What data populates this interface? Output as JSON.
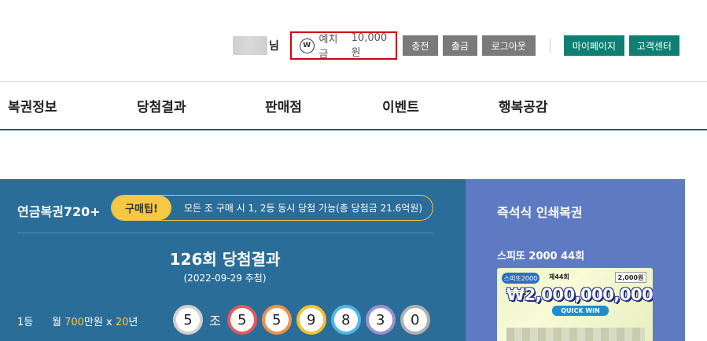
{
  "userbar": {
    "suffix": "님",
    "deposit_icon": "W",
    "deposit_label": "예치금",
    "deposit_value": "10,000원",
    "buttons": {
      "charge": "충전",
      "withdraw": "출금",
      "logout": "로그아웃",
      "mypage": "마이페이지",
      "service": "고객센터"
    }
  },
  "nav": [
    "복권정보",
    "당첨결과",
    "판매점",
    "이벤트",
    "행복공감"
  ],
  "result": {
    "product": "연금복권720+",
    "tip_label": "구매팁!",
    "tip_text": "모든 조 구매 시 1, 2등 동시 당첨 가능(총 당첨금 21.6억원)",
    "draw_title": "126회 당첨결과",
    "draw_date": "(2022-09-29 추첨)",
    "rank": "1등",
    "prize_prefix": "월 ",
    "prize_amount": "700",
    "prize_unit": "만원 x ",
    "prize_years": "20",
    "prize_suffix": "년",
    "group": "5",
    "group_suffix": "조",
    "numbers": [
      "5",
      "5",
      "9",
      "8",
      "3",
      "0"
    ],
    "ball_colors": {
      "group": "#d0d0d0",
      "numbers": [
        "#e35a5a",
        "#f0924a",
        "#f1c232",
        "#4fb7e8",
        "#9a8fd1",
        "#b0b0b0"
      ]
    }
  },
  "instant": {
    "title": "즉석식 인쇄복권",
    "product": "스피또 2000 44회",
    "ticket": {
      "logo": "스피또2000",
      "edition": "제44회",
      "price": "2,000원",
      "amount": "₩2,000,000,000",
      "badge": "QUICK WIN"
    }
  }
}
